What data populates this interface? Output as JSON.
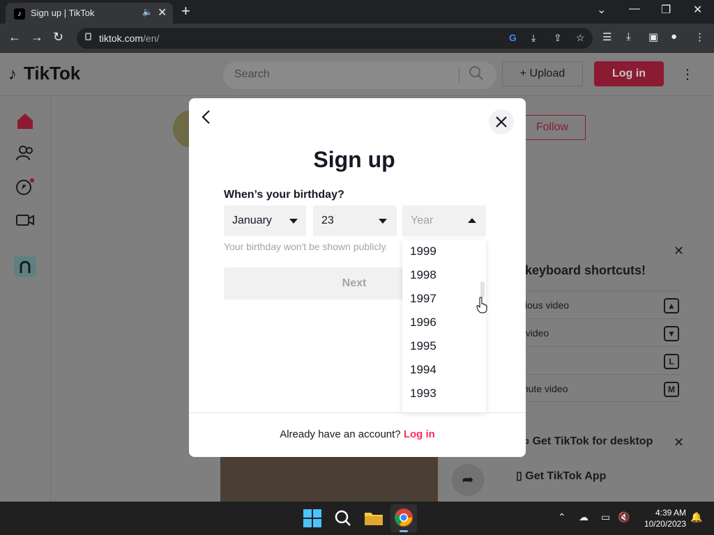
{
  "browser": {
    "tab_title": "Sign up | TikTok",
    "url_host": "tiktok.com",
    "url_path": "/en/"
  },
  "header": {
    "logo": "TikTok",
    "search_placeholder": "Search",
    "upload_label": "Upload",
    "login_label": "Log in"
  },
  "background": {
    "follow_label": "Follow",
    "shortcuts_title": "ucing keyboard shortcuts!",
    "shortcuts": [
      {
        "label": "vious video",
        "key": "▲"
      },
      {
        "label": "t video",
        "key": "▼"
      },
      {
        "label": "o",
        "key": "L"
      },
      {
        "label": "mute video",
        "key": "M"
      }
    ],
    "get_desktop": "Get TikTok for desktop",
    "get_app": "Get TikTok App"
  },
  "modal": {
    "title": "Sign up",
    "birthday_label": "When’s your birthday?",
    "month_value": "January",
    "day_value": "23",
    "year_placeholder": "Year",
    "hint": "Your birthday won't be shown publicly.",
    "next_label": "Next",
    "years": [
      "1999",
      "1998",
      "1997",
      "1996",
      "1995",
      "1994",
      "1993"
    ],
    "footer_text": "Already have an account?",
    "footer_link": "Log in"
  },
  "taskbar": {
    "time": "4:39 AM",
    "date": "10/20/2023"
  },
  "colors": {
    "brand": "#fe2c55",
    "title_text": "#161823",
    "input_bg": "#f1f1f2"
  }
}
